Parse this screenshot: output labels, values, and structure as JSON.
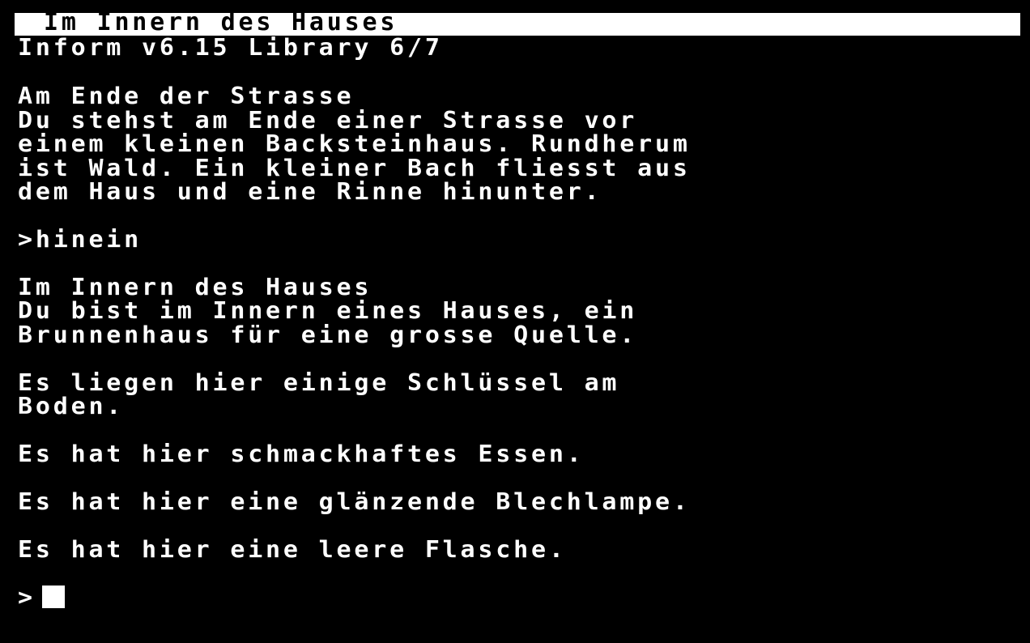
{
  "colors": {
    "background": "#000000",
    "foreground": "#ffffff"
  },
  "status_bar": {
    "location": "Im Innern des Hauses"
  },
  "transcript": {
    "banner": "Inform v6.15 Library 6/7",
    "room1_title": "Am Ende der Strasse",
    "room1_desc": [
      "Du stehst am Ende einer Strasse vor",
      "einem kleinen Backsteinhaus. Rundherum",
      "ist Wald. Ein kleiner Bach fliesst aus",
      "dem Haus und eine Rinne hinunter."
    ],
    "command1": ">hinein",
    "room2_title": "Im Innern des Hauses",
    "room2_desc": [
      "Du bist im Innern eines Hauses, ein",
      "Brunnenhaus für eine grosse Quelle."
    ],
    "objects1": [
      "Es liegen hier einige Schlüssel am",
      "Boden."
    ],
    "object_food": "Es hat hier schmackhaftes Essen.",
    "object_lamp": "Es hat hier eine glänzende Blechlampe.",
    "object_bottle": "Es hat hier eine leere Flasche.",
    "prompt": ">"
  }
}
